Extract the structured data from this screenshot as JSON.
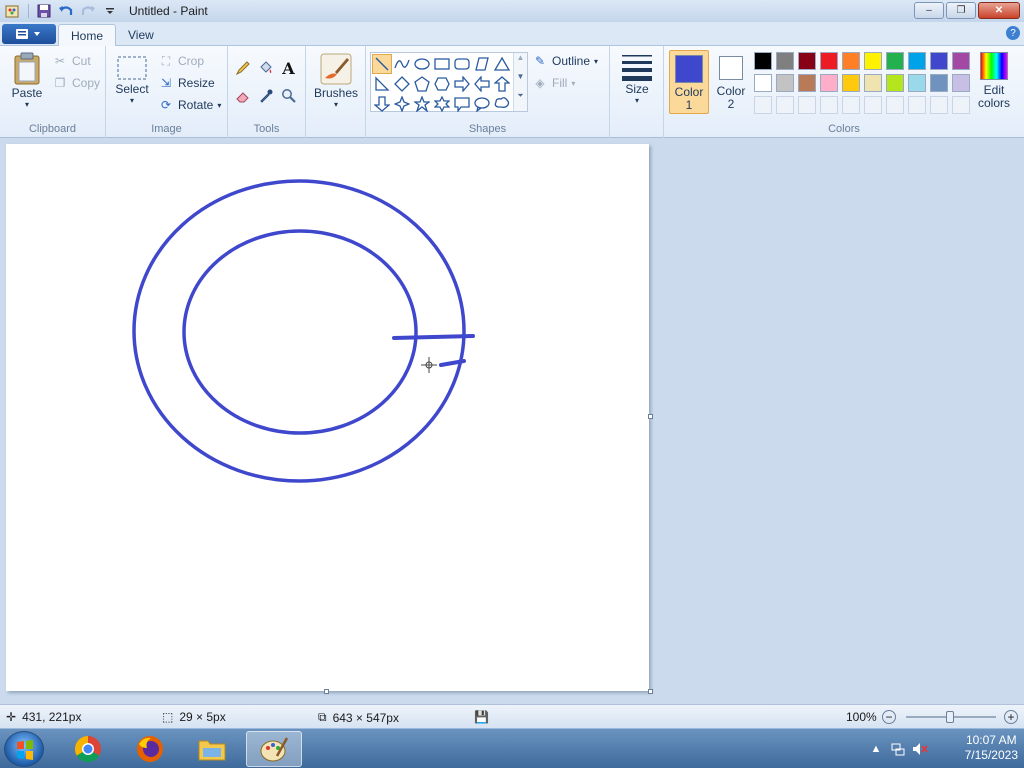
{
  "window": {
    "title": "Untitled - Paint",
    "controls": {
      "minimize": "‒",
      "maximize": "❐",
      "close": "✕"
    }
  },
  "quick_access": {
    "save_icon": "save-icon",
    "undo_icon": "undo-icon",
    "redo_icon": "redo-icon",
    "customize_icon": "dropdown-icon"
  },
  "tabs": [
    {
      "label": "Home",
      "active": true
    },
    {
      "label": "View",
      "active": false
    }
  ],
  "ribbon": {
    "clipboard": {
      "label": "Clipboard",
      "paste": "Paste",
      "cut": "Cut",
      "copy": "Copy"
    },
    "image": {
      "label": "Image",
      "select": "Select",
      "crop": "Crop",
      "resize": "Resize",
      "rotate": "Rotate"
    },
    "tools": {
      "label": "Tools",
      "text_glyph": "A"
    },
    "brushes": {
      "label": "Brushes"
    },
    "shapes": {
      "label": "Shapes",
      "outline": "Outline",
      "fill": "Fill"
    },
    "size": {
      "label": "Size"
    },
    "colors": {
      "label": "Colors",
      "color1": {
        "line1": "Color",
        "line2": "1",
        "value": "#3f48cc"
      },
      "color2": {
        "line1": "Color",
        "line2": "2",
        "value": "#ffffff"
      },
      "edit": {
        "line1": "Edit",
        "line2": "colors"
      },
      "palette_row1": [
        "#000000",
        "#7f7f7f",
        "#880015",
        "#ed1c24",
        "#ff7f27",
        "#fff200",
        "#22b14c",
        "#00a2e8",
        "#3f48cc",
        "#a349a4"
      ],
      "palette_row2": [
        "#ffffff",
        "#c3c3c3",
        "#b97a57",
        "#ffaec9",
        "#ffc90e",
        "#efe4b0",
        "#b5e61d",
        "#99d9ea",
        "#7092be",
        "#c8bfe7"
      ]
    }
  },
  "drawing": {
    "stroke_color": "#3f48cc",
    "shapes": [
      "outer-ellipse",
      "inner-ellipse",
      "line",
      "line"
    ]
  },
  "status": {
    "cursor_pos": "431, 221px",
    "selection_size": "29 × 5px",
    "image_size": "643 × 547px",
    "zoom": "100%"
  },
  "taskbar": {
    "apps": [
      "chrome",
      "firefox",
      "file-explorer",
      "paint"
    ],
    "time": "10:07 AM",
    "date": "7/15/2023"
  }
}
